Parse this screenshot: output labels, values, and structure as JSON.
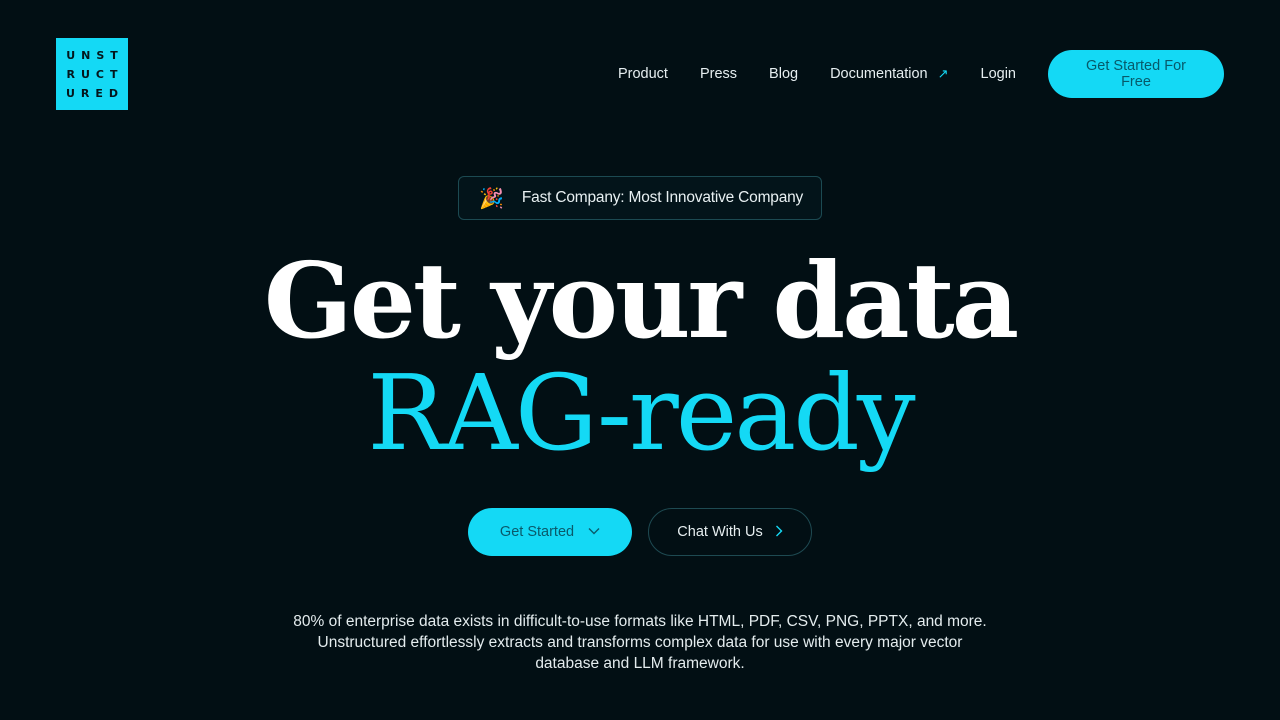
{
  "brand": {
    "logo_lines": [
      "UNST",
      "RUCT",
      "URED"
    ],
    "accent_color": "#14d9f5",
    "background_color": "#020f14"
  },
  "nav": {
    "items": [
      {
        "label": "Product"
      },
      {
        "label": "Press"
      },
      {
        "label": "Blog"
      },
      {
        "label": "Documentation",
        "icon": "external-arrow-icon",
        "icon_glyph": "↗"
      },
      {
        "label": "Login"
      }
    ],
    "cta_label": "Get Started For Free"
  },
  "badge": {
    "icon": "party-popper-icon",
    "icon_glyph": "🎉",
    "text": "Fast Company: Most Innovative Company"
  },
  "hero": {
    "headline_line1": "Get your data",
    "headline_line2": "RAG-ready",
    "primary_button": {
      "label": "Get Started",
      "icon": "chevron-down-icon",
      "icon_glyph": "⌵"
    },
    "secondary_button": {
      "label": "Chat With Us",
      "icon": "chevron-right-icon",
      "icon_glyph": "›"
    },
    "description_lines": [
      "80% of enterprise data exists in difficult-to-use formats like HTML, PDF, CSV, PNG, PPTX, and more.",
      "Unstructured effortlessly extracts and transforms complex data for use with every major vector",
      "database and LLM framework."
    ]
  }
}
